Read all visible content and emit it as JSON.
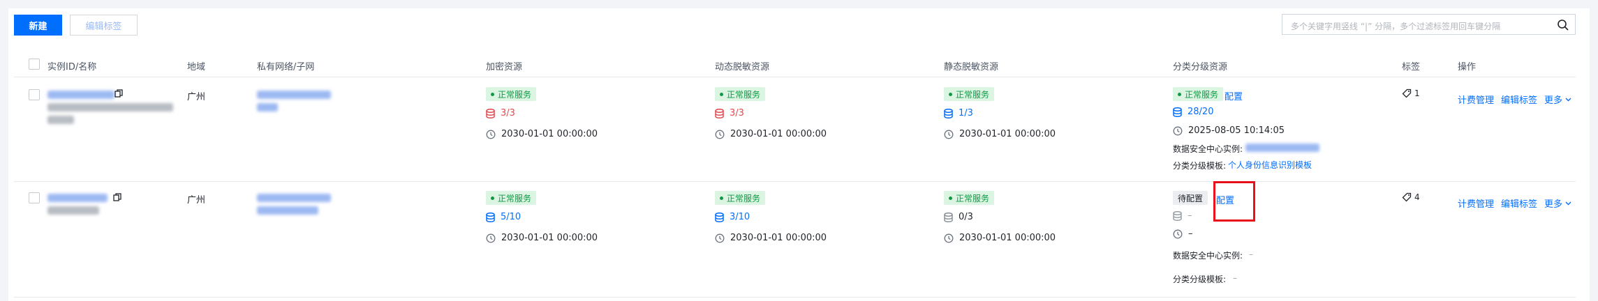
{
  "toolbar": {
    "new_label": "新建",
    "edit_tags_label": "编辑标签",
    "search_placeholder": "多个关键字用竖线 “|” 分隔，多个过滤标签用回车键分隔"
  },
  "table": {
    "headers": [
      "实例ID/名称",
      "地域",
      "私有网络/子网",
      "加密资源",
      "动态脱敏资源",
      "静态脱敏资源",
      "分类分级资源",
      "标签",
      "操作"
    ],
    "rows": [
      {
        "region": "广州",
        "encrypt": {
          "status": "正常服务",
          "count": "3/3",
          "expire": "2030-01-01 00:00:00"
        },
        "dynamic": {
          "status": "正常服务",
          "count": "3/3",
          "expire": "2030-01-01 00:00:00"
        },
        "static": {
          "status": "正常服务",
          "count": "1/3",
          "expire": "2030-01-01 00:00:00"
        },
        "classify": {
          "status": "正常服务",
          "config": "配置",
          "count": "28/20",
          "time": "2025-08-05 10:14:05",
          "dsc_label": "数据安全中心实例:",
          "template_label": "分类分级模板:",
          "template_value": "个人身份信息识别模板"
        },
        "tags": "1",
        "ops": {
          "billing": "计费管理",
          "edit_tags": "编辑标签",
          "more": "更多"
        }
      },
      {
        "region": "广州",
        "encrypt": {
          "status": "正常服务",
          "count": "5/10",
          "expire": "2030-01-01 00:00:00"
        },
        "dynamic": {
          "status": "正常服务",
          "count": "3/10",
          "expire": "2030-01-01 00:00:00"
        },
        "static": {
          "status": "正常服务",
          "count": "0/3",
          "expire": "2030-01-01 00:00:00"
        },
        "classify": {
          "status": "待配置",
          "config": "配置",
          "count": "–",
          "time": "–",
          "dsc_label": "数据安全中心实例:",
          "dsc_value": "–",
          "template_label": "分类分级模板:",
          "template_value": "–"
        },
        "tags": "4",
        "ops": {
          "billing": "计费管理",
          "edit_tags": "编辑标签",
          "more": "更多"
        }
      }
    ]
  },
  "colors": {
    "primary": "#006eff",
    "ok": "#0e9a45",
    "danger": "#e5484d",
    "highlight": "#e8111b"
  }
}
